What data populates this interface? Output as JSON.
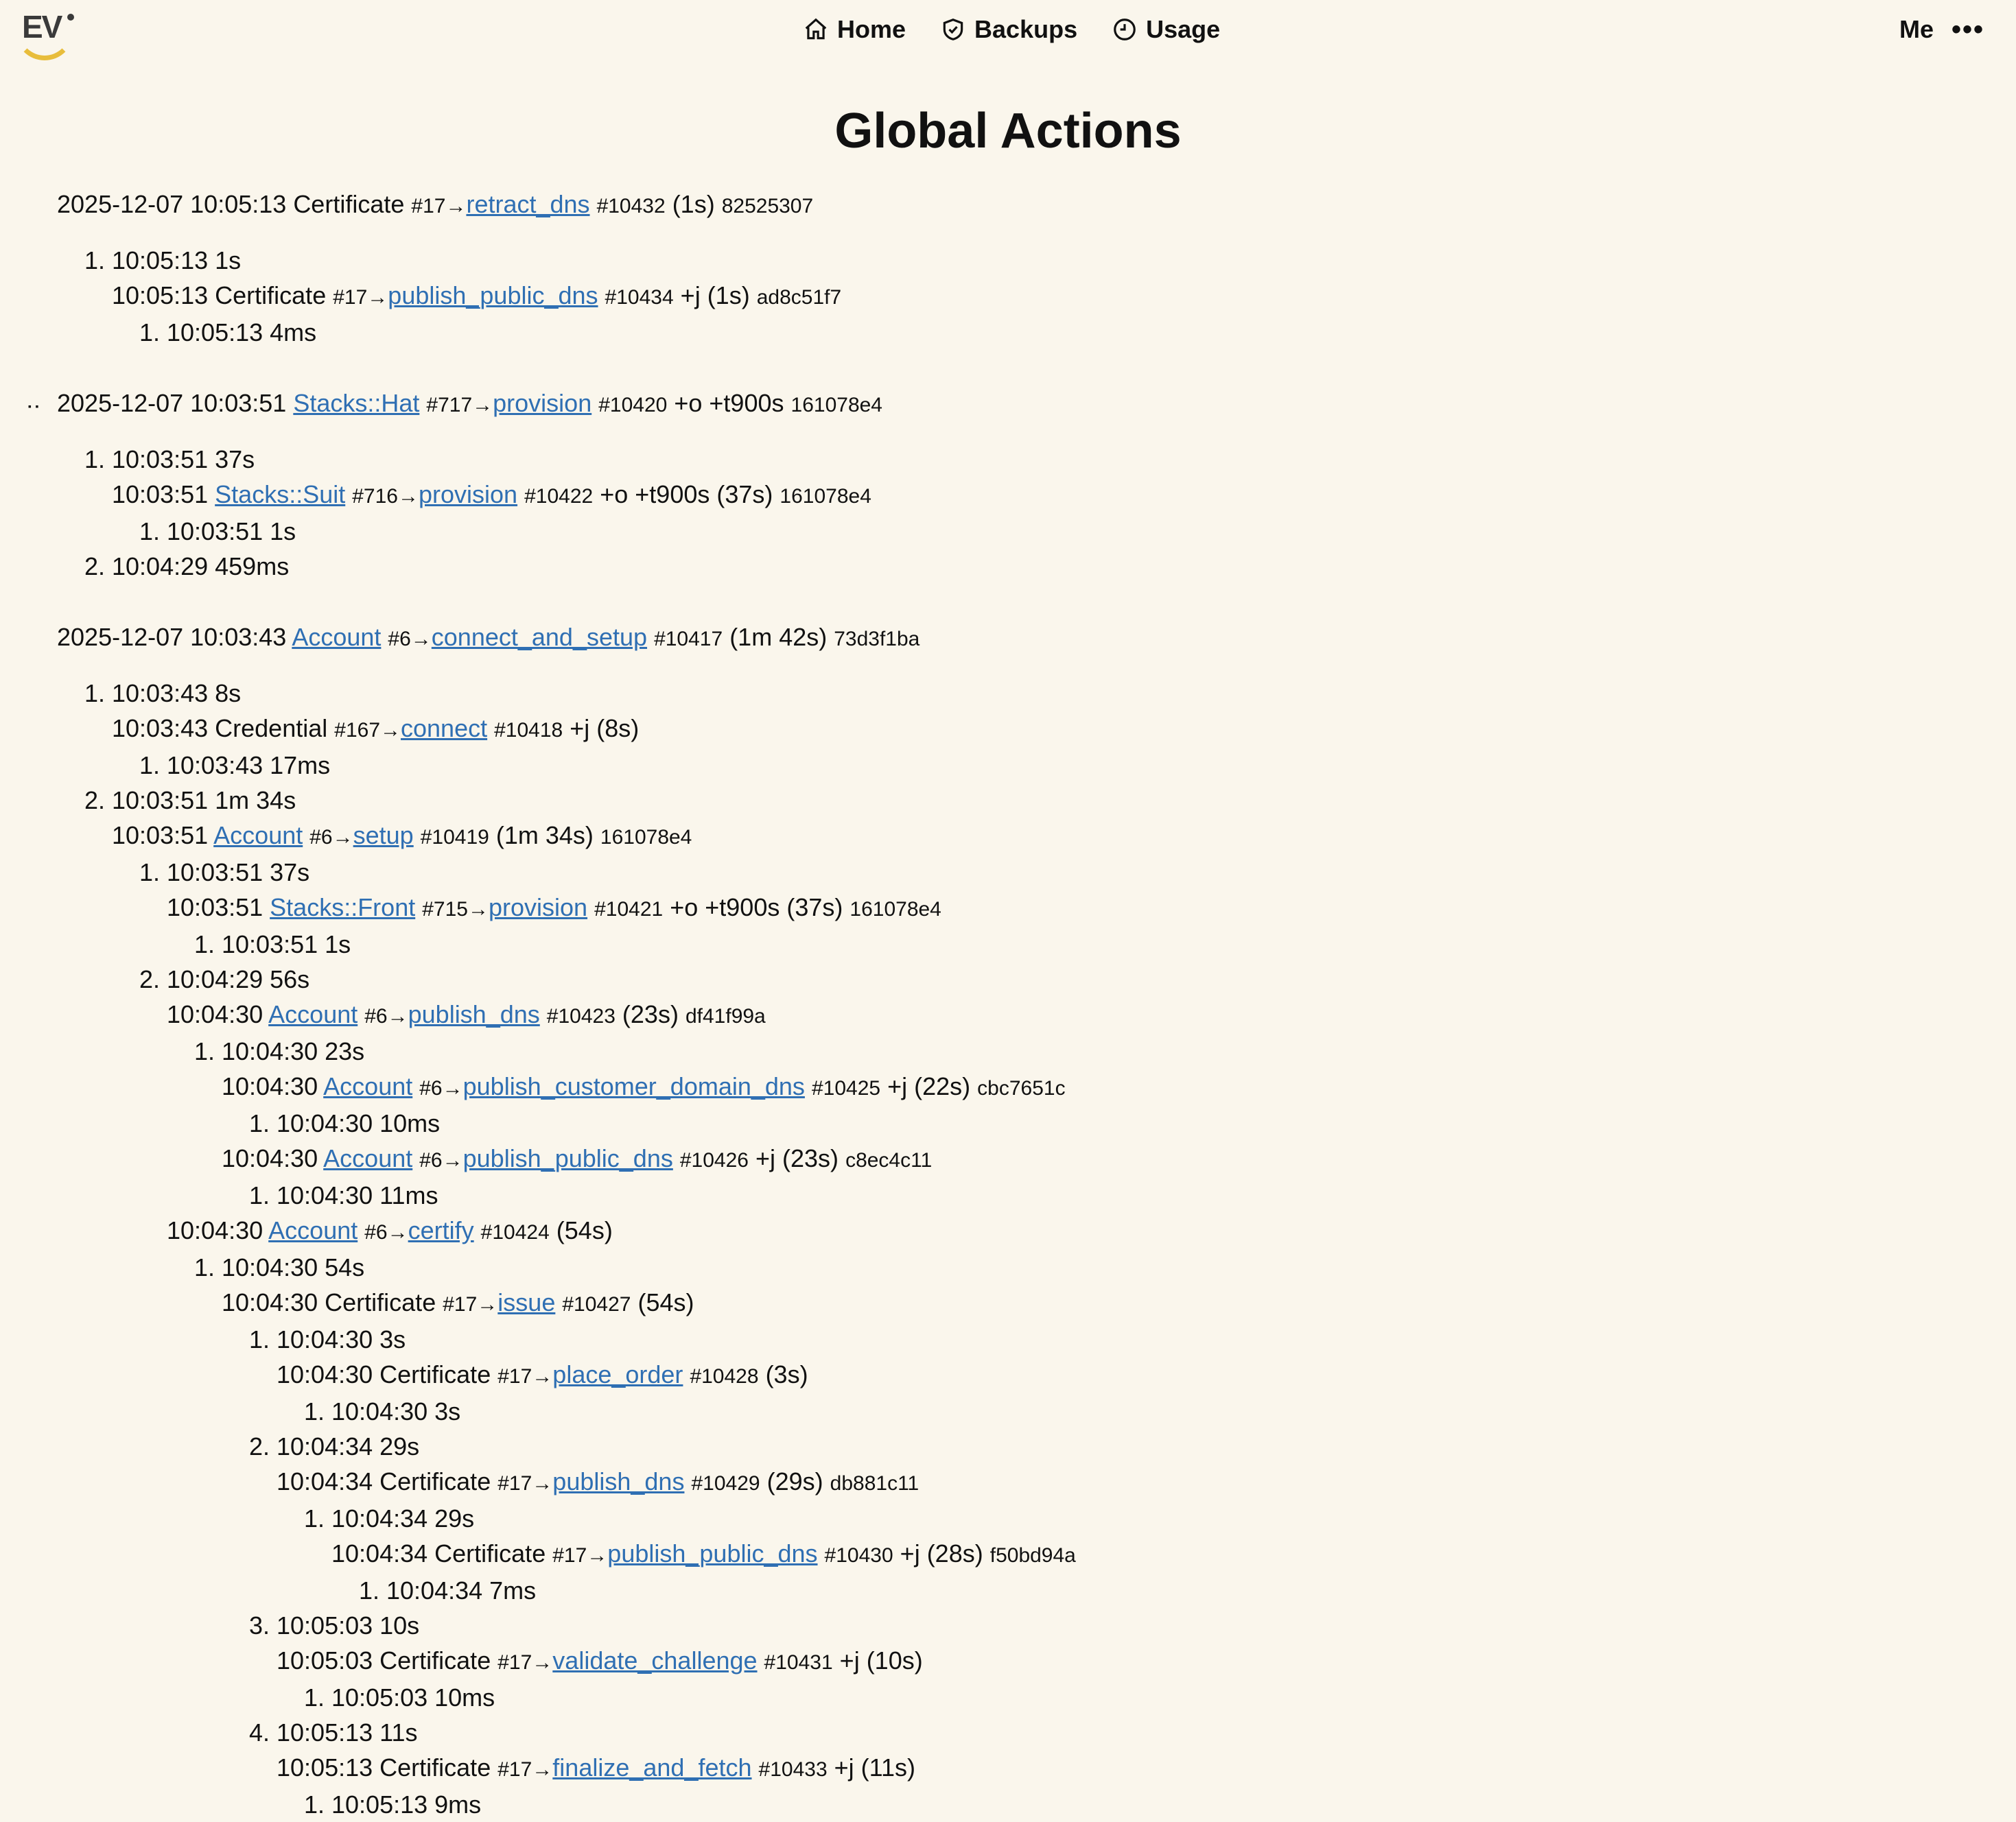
{
  "header": {
    "logo_text": "EV",
    "nav": [
      {
        "label": "Home",
        "icon": "home-icon"
      },
      {
        "label": "Backups",
        "icon": "shield-check-icon"
      },
      {
        "label": "Usage",
        "icon": "clock-icon"
      }
    ],
    "me_label": "Me",
    "more_icon": "more-dots-icon"
  },
  "page_title": "Global Actions",
  "entries": [
    {
      "ts": "2025-12-07 10:05:13",
      "model": "Certificate",
      "model_link": false,
      "id": "#17→",
      "action": "retract_dns",
      "action_id": "#10432",
      "flags": "(1s)",
      "hash": "82525307"
    },
    {
      "ts": "2025-12-07 10:03:51",
      "model": "Stacks::Hat",
      "model_link": true,
      "id": "#717→",
      "action": "provision",
      "action_id": "#10420",
      "flags": "+o +t900s",
      "hash": "161078e4"
    },
    {
      "ts": "2025-12-07 10:03:43",
      "model": "Account",
      "model_link": true,
      "id": "#6→",
      "action": "connect_and_setup",
      "action_id": "#10417",
      "flags": "(1m 42s)",
      "hash": "73d3f1ba"
    }
  ],
  "e1": {
    "s1": "10:05:13 1s",
    "c1": {
      "ts": "10:05:13",
      "model": "Certificate",
      "id": "#17→",
      "action": "publish_public_dns",
      "action_id": "#10434",
      "flags": "+j (1s)",
      "hash": "ad8c51f7"
    },
    "c1s1": "10:05:13 4ms"
  },
  "e2": {
    "s1": "10:03:51 37s",
    "c1": {
      "ts": "10:03:51",
      "model": "Stacks::Suit",
      "id": "#716→",
      "action": "provision",
      "action_id": "#10422",
      "flags": "+o +t900s (37s)",
      "hash": "161078e4"
    },
    "c1s1": "10:03:51 1s",
    "s2": "10:04:29 459ms"
  },
  "e3": {
    "s1": "10:03:43 8s",
    "c1": {
      "ts": "10:03:43",
      "model": "Credential",
      "id": "#167→",
      "action": "connect",
      "action_id": "#10418",
      "flags": "+j (8s)"
    },
    "c1s1": "10:03:43 17ms",
    "s2": "10:03:51 1m 34s",
    "c2": {
      "ts": "10:03:51",
      "model": "Account",
      "id": "#6→",
      "action": "setup",
      "action_id": "#10419",
      "flags": "(1m 34s)",
      "hash": "161078e4"
    },
    "c2s1": "10:03:51 37s",
    "c2c1": {
      "ts": "10:03:51",
      "model": "Stacks::Front",
      "id": "#715→",
      "action": "provision",
      "action_id": "#10421",
      "flags": "+o +t900s (37s)",
      "hash": "161078e4"
    },
    "c2c1s1": "10:03:51 1s",
    "c2s2": "10:04:29 56s",
    "pd": {
      "ts": "10:04:30",
      "model": "Account",
      "id": "#6→",
      "action": "publish_dns",
      "action_id": "#10423",
      "flags": "(23s)",
      "hash": "df41f99a"
    },
    "pds1": "10:04:30 23s",
    "pcd": {
      "ts": "10:04:30",
      "model": "Account",
      "id": "#6→",
      "action": "publish_customer_domain_dns",
      "action_id": "#10425",
      "flags": "+j (22s)",
      "hash": "cbc7651c"
    },
    "pcds1": "10:04:30 10ms",
    "ppd": {
      "ts": "10:04:30",
      "model": "Account",
      "id": "#6→",
      "action": "publish_public_dns",
      "action_id": "#10426",
      "flags": "+j (23s)",
      "hash": "c8ec4c11"
    },
    "ppds1": "10:04:30 11ms",
    "cert": {
      "ts": "10:04:30",
      "model": "Account",
      "id": "#6→",
      "action": "certify",
      "action_id": "#10424",
      "flags": "(54s)"
    },
    "certs1": "10:04:30 54s",
    "issue": {
      "ts": "10:04:30",
      "model": "Certificate",
      "id": "#17→",
      "action": "issue",
      "action_id": "#10427",
      "flags": "(54s)"
    },
    "is1": "10:04:30 3s",
    "po": {
      "ts": "10:04:30",
      "model": "Certificate",
      "id": "#17→",
      "action": "place_order",
      "action_id": "#10428",
      "flags": "(3s)"
    },
    "pos1": "10:04:30 3s",
    "is2": "10:04:34 29s",
    "cpd": {
      "ts": "10:04:34",
      "model": "Certificate",
      "id": "#17→",
      "action": "publish_dns",
      "action_id": "#10429",
      "flags": "(29s)",
      "hash": "db881c11"
    },
    "cpds1": "10:04:34 29s",
    "cppd": {
      "ts": "10:04:34",
      "model": "Certificate",
      "id": "#17→",
      "action": "publish_public_dns",
      "action_id": "#10430",
      "flags": "+j (28s)",
      "hash": "f50bd94a"
    },
    "cppds1": "10:04:34 7ms",
    "is3": "10:05:03 10s",
    "vc": {
      "ts": "10:05:03",
      "model": "Certificate",
      "id": "#17→",
      "action": "validate_challenge",
      "action_id": "#10431",
      "flags": "+j (10s)"
    },
    "vcs1": "10:05:03 10ms",
    "is4": "10:05:13 11s",
    "ff": {
      "ts": "10:05:13",
      "model": "Certificate",
      "id": "#17→",
      "action": "finalize_and_fetch",
      "action_id": "#10433",
      "flags": "+j (11s)"
    },
    "ffs1": "10:05:13 9ms"
  },
  "spinner_glyph": "⠐⠂"
}
